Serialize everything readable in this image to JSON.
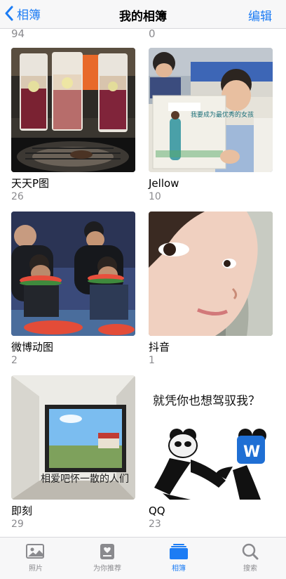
{
  "nav": {
    "back_label": "相簿",
    "title": "我的相簿",
    "edit_label": "编辑"
  },
  "partial_counts": [
    "94",
    "0"
  ],
  "albums": [
    {
      "title": "天天P图",
      "count": "26"
    },
    {
      "title": "Jellow",
      "count": "10"
    },
    {
      "title": "微博动图",
      "count": "2"
    },
    {
      "title": "抖音",
      "count": "1"
    },
    {
      "title": "即刻",
      "count": "29"
    },
    {
      "title": "QQ",
      "count": "23"
    }
  ],
  "thumb_text": {
    "book_title": "我要成为最优秀的女孩",
    "meme_caption": "就凭你也想驾驭我？",
    "wall_graffiti": "相爱吧怀一散的人们",
    "word_letter": "W"
  },
  "tabs": [
    {
      "label": "照片"
    },
    {
      "label": "为你推荐"
    },
    {
      "label": "相簿"
    },
    {
      "label": "搜索"
    }
  ],
  "colors": {
    "accent": "#1c7cf4",
    "secondary_text": "#8a8a8e",
    "bar_background": "#f7f7f8"
  }
}
